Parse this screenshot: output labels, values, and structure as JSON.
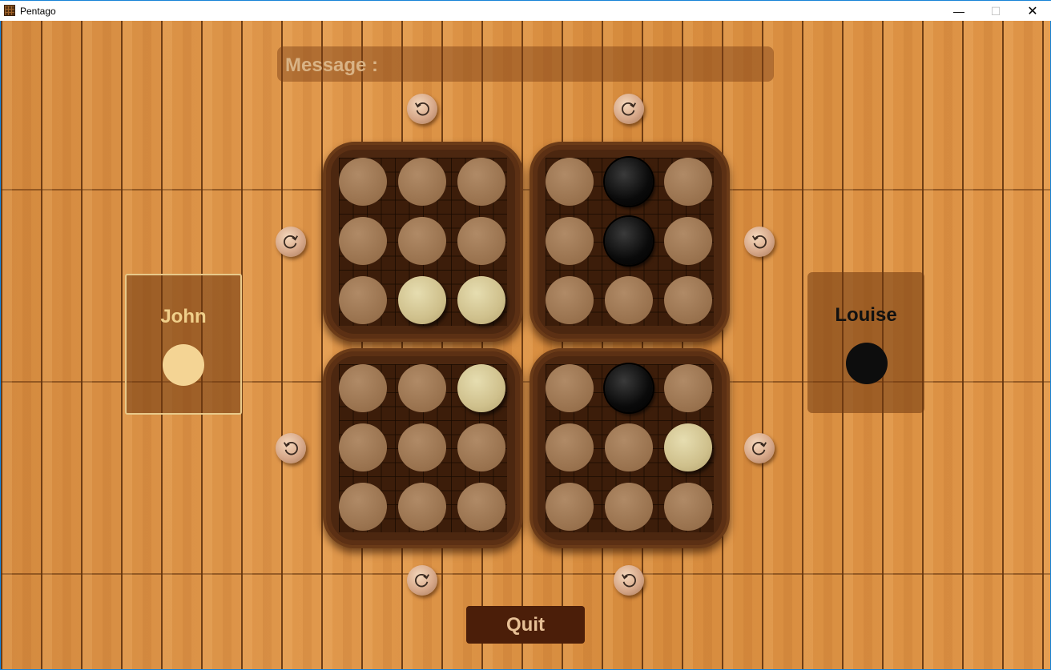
{
  "window": {
    "title": "Pentago",
    "minimize": "—",
    "maximize": "☐",
    "close": "✕"
  },
  "message": {
    "label": "Message :",
    "text": ""
  },
  "players": [
    {
      "name": "John",
      "color": "white",
      "active": true
    },
    {
      "name": "Louise",
      "color": "black",
      "active": false
    }
  ],
  "board": {
    "quadrants": [
      {
        "id": "top-left",
        "cells": [
          "empty",
          "empty",
          "empty",
          "empty",
          "empty",
          "empty",
          "empty",
          "white",
          "white"
        ]
      },
      {
        "id": "top-right",
        "cells": [
          "empty",
          "black",
          "empty",
          "empty",
          "black",
          "empty",
          "empty",
          "empty",
          "empty"
        ]
      },
      {
        "id": "bottom-left",
        "cells": [
          "empty",
          "empty",
          "white",
          "empty",
          "empty",
          "empty",
          "empty",
          "empty",
          "empty"
        ]
      },
      {
        "id": "bottom-right",
        "cells": [
          "empty",
          "black",
          "empty",
          "empty",
          "empty",
          "white",
          "empty",
          "empty",
          "empty"
        ]
      }
    ]
  },
  "rotate_buttons": [
    {
      "quadrant": "top-left",
      "direction": "counterclockwise",
      "icon": "rotate-ccw-icon"
    },
    {
      "quadrant": "top-right",
      "direction": "clockwise",
      "icon": "rotate-cw-icon"
    },
    {
      "quadrant": "top-left",
      "direction": "clockwise",
      "icon": "rotate-cw-icon"
    },
    {
      "quadrant": "top-right",
      "direction": "counterclockwise",
      "icon": "rotate-ccw-icon"
    },
    {
      "quadrant": "bottom-left",
      "direction": "counterclockwise",
      "icon": "rotate-ccw-icon"
    },
    {
      "quadrant": "bottom-right",
      "direction": "clockwise",
      "icon": "rotate-cw-icon"
    },
    {
      "quadrant": "bottom-left",
      "direction": "clockwise",
      "icon": "rotate-cw-icon"
    },
    {
      "quadrant": "bottom-right",
      "direction": "counterclockwise",
      "icon": "rotate-ccw-icon"
    }
  ],
  "quit_label": "Quit",
  "colors": {
    "wood": "#d98c3e",
    "board": "#4c2710",
    "quit_bg": "#4b1e09",
    "quit_text": "#e6bf95"
  }
}
